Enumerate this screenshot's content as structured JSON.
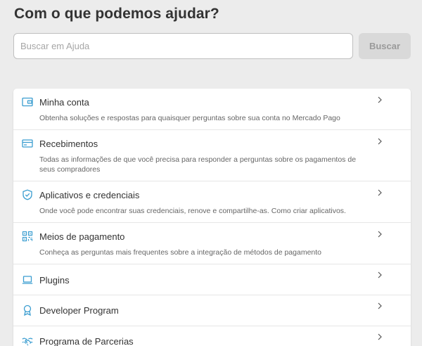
{
  "header": {
    "title": "Com o que podemos ajudar?"
  },
  "search": {
    "placeholder": "Buscar em Ajuda",
    "value": "",
    "button_label": "Buscar"
  },
  "colors": {
    "accent": "#3a9dd0",
    "button_disabled_bg": "#d9d9d9",
    "button_disabled_text": "#9a9a9a",
    "page_bg": "#ececec"
  },
  "topics": [
    {
      "icon": "wallet-icon",
      "title": "Minha conta",
      "description": "Obtenha soluções e respostas para quaisquer perguntas sobre sua conta no Mercado Pago"
    },
    {
      "icon": "credit-card-icon",
      "title": "Recebimentos",
      "description": "Todas as informações de que você precisa para responder a perguntas sobre os pagamentos de seus compradores"
    },
    {
      "icon": "shield-check-icon",
      "title": "Aplicativos e credenciais",
      "description": "Onde você pode encontrar suas credenciais, renove e compartilhe-as. Como criar aplicativos."
    },
    {
      "icon": "qr-code-icon",
      "title": "Meios de pagamento",
      "description": "Conheça as perguntas mais frequentes sobre a integração de métodos de pagamento"
    },
    {
      "icon": "laptop-icon",
      "title": "Plugins",
      "description": ""
    },
    {
      "icon": "award-icon",
      "title": "Developer Program",
      "description": ""
    },
    {
      "icon": "handshake-icon",
      "title": "Programa de Parcerias",
      "description": ""
    }
  ]
}
